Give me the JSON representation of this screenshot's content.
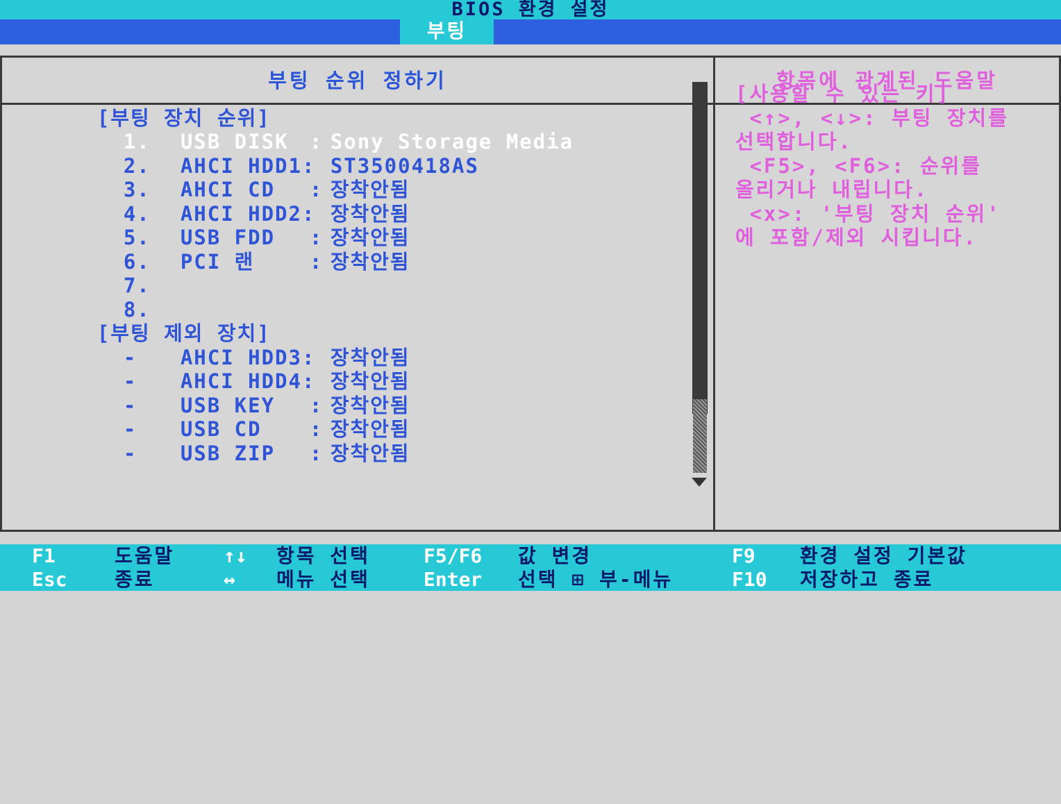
{
  "window": {
    "title": "BIOS 환경 설정"
  },
  "menu": {
    "active_tab": "부팅"
  },
  "left_panel": {
    "heading": "부팅 순위 정하기",
    "lines": [
      {
        "num": "",
        "device": "[부팅 장치 순위]",
        "sep": "",
        "value": ""
      },
      {
        "num": "1.",
        "device": "USB DISK",
        "sep": ":",
        "value": "Sony Storage Media",
        "selected": true
      },
      {
        "num": "2.",
        "device": "AHCI HDD1:",
        "sep": "",
        "value": "ST3500418AS"
      },
      {
        "num": "3.",
        "device": "AHCI CD",
        "sep": ":",
        "value": "장착안됨"
      },
      {
        "num": "4.",
        "device": "AHCI HDD2:",
        "sep": "",
        "value": "장착안됨"
      },
      {
        "num": "5.",
        "device": "USB FDD",
        "sep": ":",
        "value": "장착안됨"
      },
      {
        "num": "6.",
        "device": "PCI 랜",
        "sep": ":",
        "value": "장착안됨"
      },
      {
        "num": "7.",
        "device": "",
        "sep": "",
        "value": ""
      },
      {
        "num": "8.",
        "device": "",
        "sep": "",
        "value": ""
      },
      {
        "num": "",
        "device": "[부팅 제외 장치]",
        "sep": "",
        "value": ""
      },
      {
        "num": "-",
        "device": "AHCI HDD3:",
        "sep": "",
        "value": "장착안됨"
      },
      {
        "num": "-",
        "device": "AHCI HDD4:",
        "sep": "",
        "value": "장착안됨"
      },
      {
        "num": "-",
        "device": "USB KEY",
        "sep": ":",
        "value": "장착안됨"
      },
      {
        "num": "-",
        "device": "USB CD",
        "sep": ":",
        "value": "장착안됨"
      },
      {
        "num": "-",
        "device": "USB ZIP",
        "sep": ":",
        "value": "장착안됨"
      }
    ]
  },
  "right_panel": {
    "heading": "항목에 관계된 도움말",
    "lines": [
      "[사용할 수 있는 키]",
      " <↑>, <↓>: 부팅 장치를",
      "선택합니다.",
      " <F5>, <F6>: 순위를",
      "올리거나 내립니다.",
      " <x>: '부팅 장치 순위'",
      "에 포함/제외 시킵니다."
    ]
  },
  "footer": {
    "row1": {
      "k1": "F1",
      "d1": "도움말",
      "k2": "↑↓",
      "d2": "항목 선택",
      "k3": "F5/F6",
      "d3": "값 변경",
      "k4": "F9",
      "d4": "환경 설정 기본값"
    },
    "row2": {
      "k1": "Esc",
      "d1": "종료",
      "k2": "↔",
      "d2": "메뉴 선택",
      "k3": "Enter",
      "d3": "선택 ⊞ 부-메뉴",
      "k4": "F10",
      "d4": "저장하고 종료"
    }
  },
  "colors": {
    "background": "#d4d4d4",
    "title_bar": "#27c9d6",
    "menu_bar": "#2d5fe0",
    "item_text": "#2f54d6",
    "help_text": "#e05fdc",
    "selected_text": "#ffffff"
  }
}
